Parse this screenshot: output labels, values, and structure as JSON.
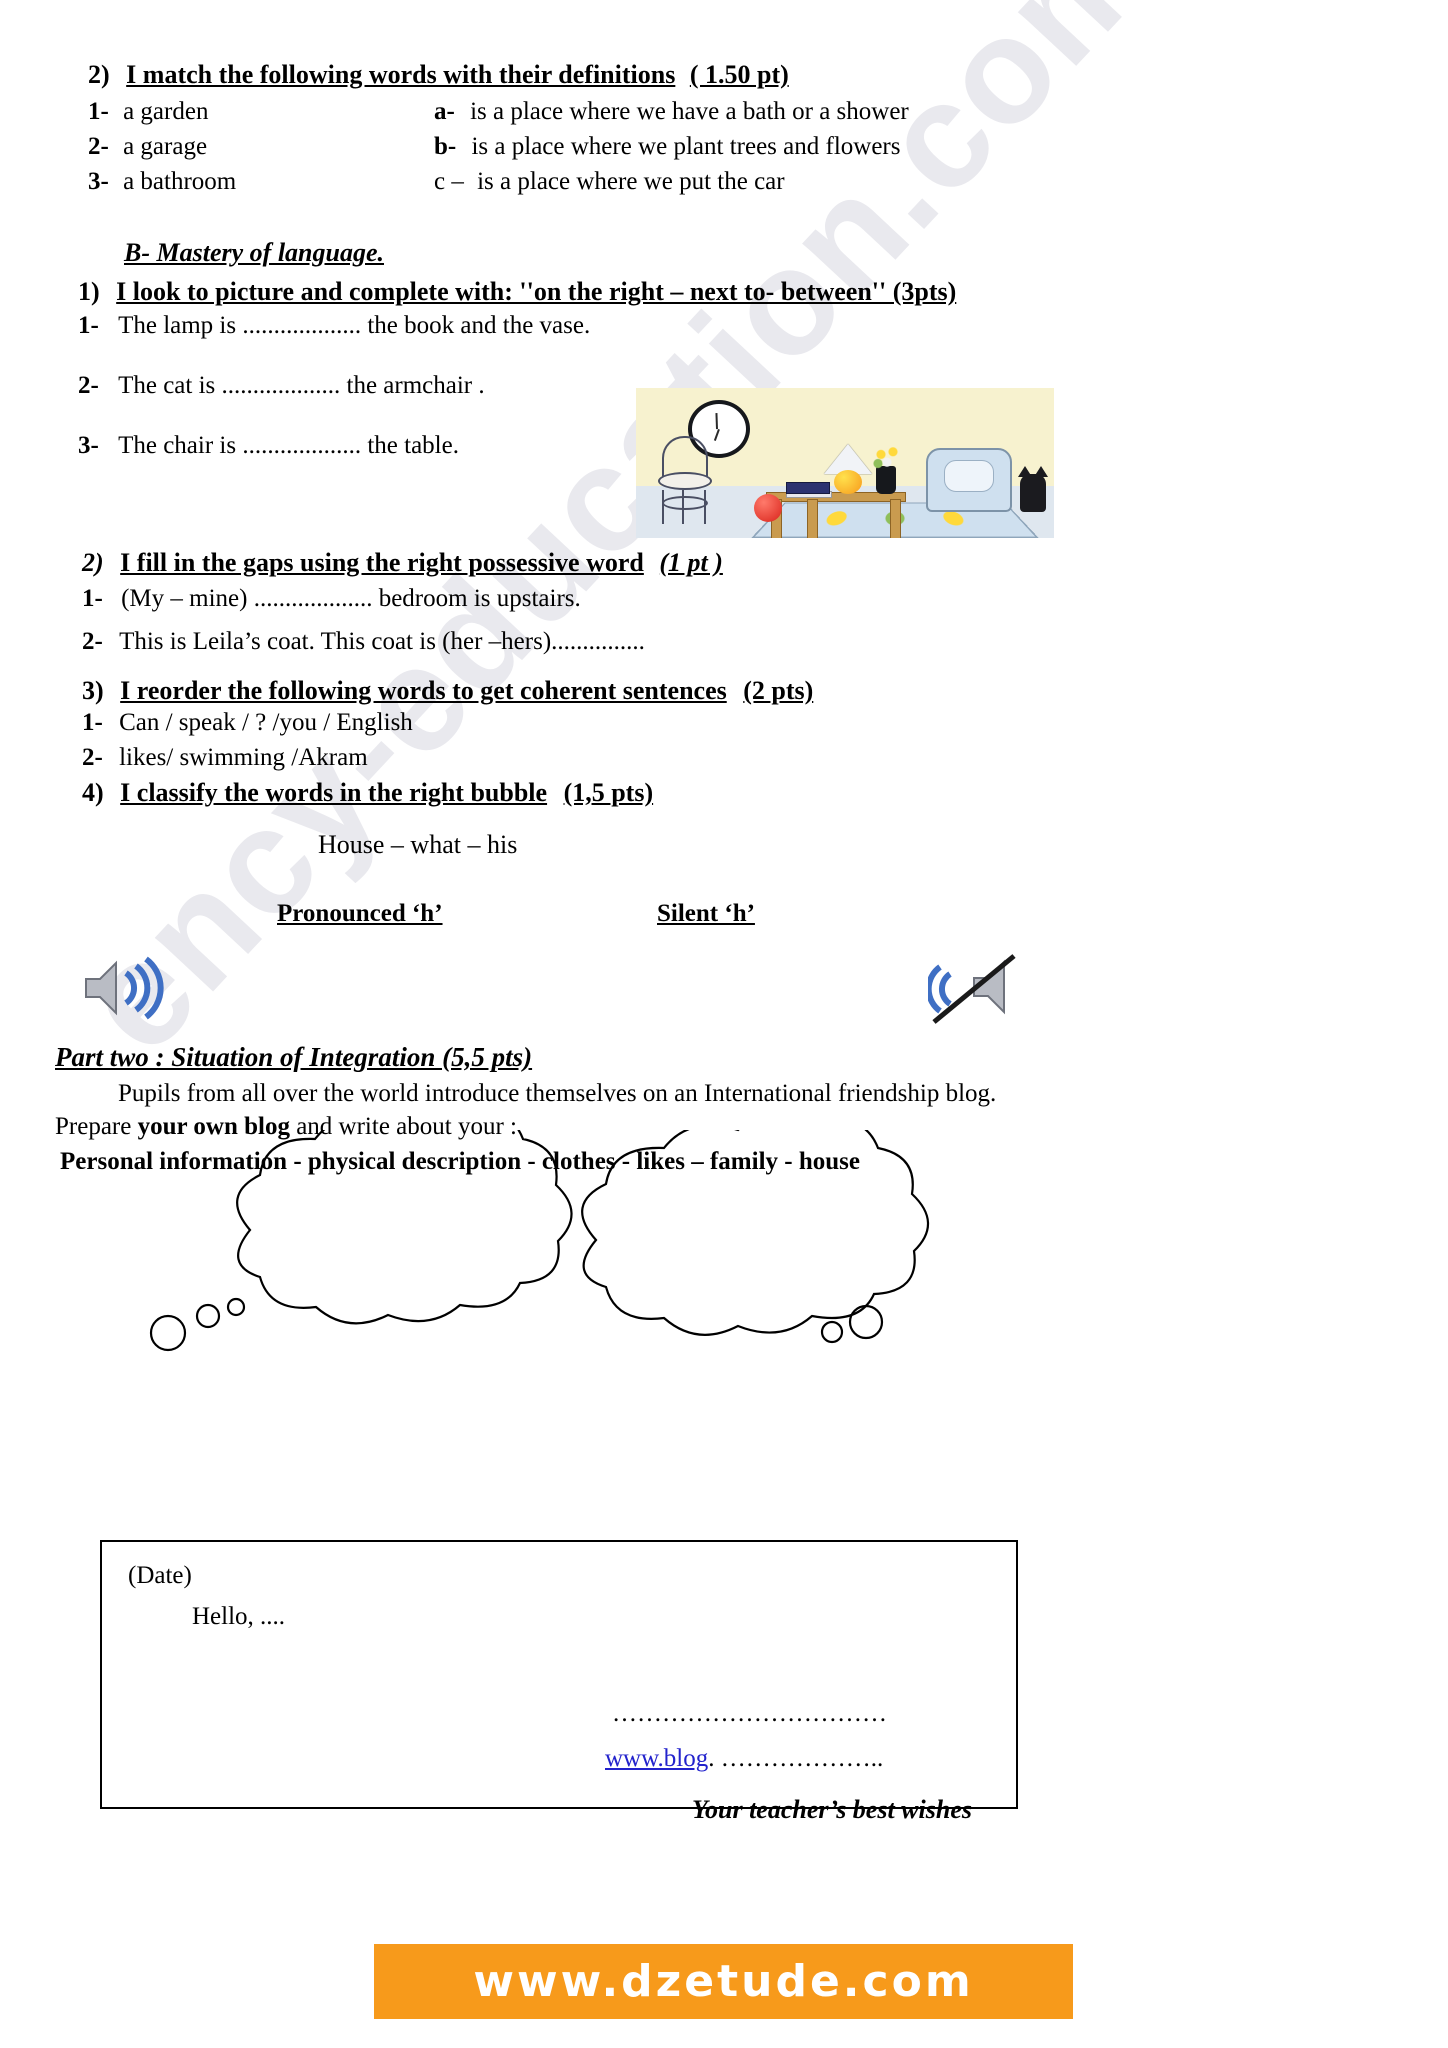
{
  "watermark": {
    "text": "ency-education.com/exams"
  },
  "exercise_match": {
    "number": "2)",
    "title": "I match the following words with their definitions",
    "points": "( 1.50 pt)",
    "left_items": [
      {
        "marker": "1-",
        "text": "a garden"
      },
      {
        "marker": "2-",
        "text": "a garage"
      },
      {
        "marker": "3-",
        "text": "a bathroom"
      }
    ],
    "right_items": [
      {
        "marker": "a-",
        "text": "is a place where we have a bath or a shower"
      },
      {
        "marker": "b-",
        "text": "is a place where we plant trees and flowers"
      },
      {
        "marker": "c –",
        "text": "is a place where we put the car"
      }
    ]
  },
  "section_b": {
    "title": "B- Mastery of language."
  },
  "exercise_prepositions": {
    "number": "1)",
    "title": "I look to picture and complete with: ''on the right – next to- between'' (3pts)",
    "items": [
      {
        "marker": "1-",
        "text": "The lamp is ................... the book and the vase."
      },
      {
        "marker": "2-",
        "text": "The cat  is ................... the armchair ."
      },
      {
        "marker": "3-",
        "text": "The chair is ................... the table."
      }
    ],
    "illustration": {
      "name": "living-room-picture",
      "objects": [
        "clock",
        "lamp",
        "book",
        "vase-with-flowers",
        "table",
        "chair",
        "armchair",
        "cat",
        "ball",
        "rug"
      ]
    }
  },
  "exercise_possessive": {
    "number": "2)",
    "title": "I fill in the gaps  using  the right  possessive word",
    "points": "(1 pt )",
    "items": [
      {
        "marker": "1-",
        "text": "(My – mine) ...................  bedroom is upstairs."
      },
      {
        "marker": "2-",
        "text": "This is Leila’s coat. This coat is (her –hers)..............."
      }
    ]
  },
  "exercise_reorder": {
    "number": "3)",
    "title": "I reorder the following words to get coherent sentences",
    "points": "(2 pts)",
    "items": [
      {
        "marker": "1-",
        "text": "Can  / speak / ? /you / English"
      },
      {
        "marker": "2-",
        "text": "likes/   swimming /Akram"
      }
    ]
  },
  "exercise_classify": {
    "number": "4)",
    "title": "I classify  the words in the  right  bubble",
    "points": "(1,5 pts)",
    "words_line": "House    –  what    –  his",
    "bubbles": [
      {
        "label": "Pronounced ‘h’",
        "icon": "speaker-sound-icon"
      },
      {
        "label": "Silent  ‘h’",
        "icon": "speaker-muted-icon"
      }
    ]
  },
  "part_two": {
    "title": "Part two : Situation of Integration (5,5 pts)",
    "intro": "Pupils from all over the world introduce themselves on an International friendship blog.",
    "prepare_prefix": "Prepare ",
    "prepare_bold": "your own blog",
    "prepare_suffix": " and write about your :",
    "topics": "Personal information   - physical description  - clothes -  likes  – family  -  house",
    "answer_box": {
      "date_label": "(Date)",
      "greeting": "Hello, ....",
      "dots_line": "……………………………",
      "blog_link": "www.blog",
      "blog_dots": ". ………………..",
      "closing": "Your teacher’s best wishes"
    }
  },
  "footer": {
    "banner_text": "www.dzetude.com",
    "banner_color": "#f79a1b"
  }
}
